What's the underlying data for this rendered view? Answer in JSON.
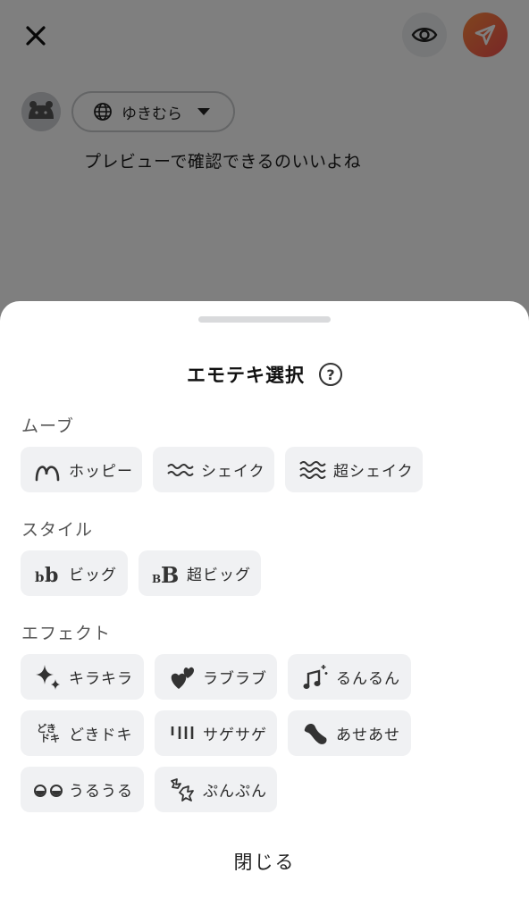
{
  "composer": {
    "account_name": "ゆきむら",
    "post_text": "プレビューで確認できるのいいよね"
  },
  "sheet": {
    "title": "エモテキ選択",
    "help_symbol": "?",
    "sections": {
      "move": {
        "label": "ムーブ",
        "items": [
          {
            "label": "ホッピー",
            "icon": "hop-arc-icon"
          },
          {
            "label": "シェイク",
            "icon": "shake-waves-icon"
          },
          {
            "label": "超シェイク",
            "icon": "super-shake-waves-icon"
          }
        ]
      },
      "style": {
        "label": "スタイル",
        "items": [
          {
            "label": "ビッグ",
            "icon": "big-text-icon",
            "glyph": "bb"
          },
          {
            "label": "超ビッグ",
            "icon": "super-big-text-icon",
            "glyph": "BB"
          }
        ]
      },
      "effect": {
        "label": "エフェクト",
        "items": [
          {
            "label": "キラキラ",
            "icon": "sparkle-icon"
          },
          {
            "label": "ラブラブ",
            "icon": "hearts-icon"
          },
          {
            "label": "るんるん",
            "icon": "music-note-icon"
          },
          {
            "label": "どきドキ",
            "icon": "dokidoki-icon",
            "glyph_top": "どき",
            "glyph_bottom": "ドキ"
          },
          {
            "label": "サゲサゲ",
            "icon": "down-lines-icon"
          },
          {
            "label": "あせあせ",
            "icon": "sweat-drop-icon"
          },
          {
            "label": "うるうる",
            "icon": "teary-eyes-icon"
          },
          {
            "label": "ぷんぷん",
            "icon": "anger-sparks-icon"
          }
        ]
      }
    },
    "close_label": "閉じる"
  }
}
